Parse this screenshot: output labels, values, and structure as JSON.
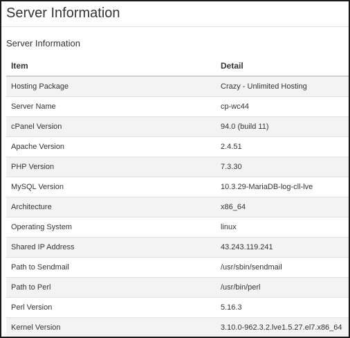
{
  "page": {
    "title": "Server Information"
  },
  "section": {
    "title": "Server Information"
  },
  "table": {
    "headers": {
      "item": "Item",
      "detail": "Detail"
    },
    "rows": [
      {
        "item": "Hosting Package",
        "detail": "Crazy - Unlimited Hosting"
      },
      {
        "item": "Server Name",
        "detail": "cp-wc44"
      },
      {
        "item": "cPanel Version",
        "detail": "94.0 (build 11)"
      },
      {
        "item": "Apache Version",
        "detail": "2.4.51"
      },
      {
        "item": "PHP Version",
        "detail": "7.3.30"
      },
      {
        "item": "MySQL Version",
        "detail": "10.3.29-MariaDB-log-cll-lve"
      },
      {
        "item": "Architecture",
        "detail": "x86_64"
      },
      {
        "item": "Operating System",
        "detail": "linux"
      },
      {
        "item": "Shared IP Address",
        "detail": "43.243.119.241"
      },
      {
        "item": "Path to Sendmail",
        "detail": "/usr/sbin/sendmail"
      },
      {
        "item": "Path to Perl",
        "detail": "/usr/bin/perl"
      },
      {
        "item": "Perl Version",
        "detail": "5.16.3"
      },
      {
        "item": "Kernel Version",
        "detail": "3.10.0-962.3.2.lve1.5.27.el7.x86_64"
      }
    ]
  }
}
